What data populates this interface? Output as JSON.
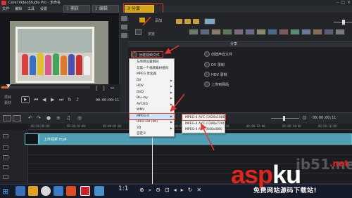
{
  "titlebar": {
    "title": "Corel VideoStudio Pro - 未命名"
  },
  "menubar": {
    "items": [
      "文件",
      "编辑",
      "工具",
      "设置"
    ]
  },
  "steps": {
    "capture": {
      "num": "1",
      "label": "捕获"
    },
    "edit": {
      "num": "2",
      "label": "编辑"
    },
    "share": {
      "num": "3",
      "label": "分享"
    }
  },
  "library": {
    "add_label": "添加",
    "browse_label": "浏览"
  },
  "share_panel": {
    "header": "分享",
    "create_video": "创建视频文件",
    "create_audio": "创建声音文件",
    "dv_record": "DV 录制",
    "hdv_record": "HDV 录制",
    "upload_web": "上传到网站"
  },
  "menu_create_video": {
    "items": [
      "与项目设置相同",
      "与第一个视频素材相同",
      "MPEG 优化器",
      "DV",
      "HDV",
      "DVD",
      "Blu-ray",
      "AVCHD",
      "WMV",
      "MPEG-4",
      "Ultra HD (4K)",
      "3D",
      "自定义"
    ],
    "submenu_flags": [
      false,
      false,
      false,
      true,
      true,
      true,
      true,
      true,
      true,
      true,
      true,
      true,
      false
    ],
    "hover_index": 9
  },
  "menu_mpeg4": {
    "items": [
      "MPEG-4 AVC (1920x1080)",
      "MPEG-4 AVC (1280x720)",
      "MPEG-4 AVC (640x480)"
    ]
  },
  "preview": {
    "timecode": "00:00:00:11",
    "progress": 0.08,
    "mode_project": "项目",
    "mode_clip": "素材"
  },
  "timeline": {
    "ruler_labels": [
      "00:00:00:00",
      "00:00:02:00",
      "00:00:04:00",
      "00:00:06:00",
      "00:00:08:00",
      "00:00:10:00",
      "00:00:12:00",
      "00:00:14:00",
      "00:00:16:00"
    ],
    "clip_name": "上传视频.mp4"
  },
  "taskbar": {
    "zoom_label": "1:1"
  },
  "watermark": {
    "brand_a": "asp",
    "brand_b": "ku",
    "brand_tld": ".net",
    "subtitle": "免费网站源码下载站!",
    "faint": "jb51.net"
  },
  "colors": {
    "accent_orange": "#d8a417",
    "highlight_red": "#e43a2a",
    "clip_blue": "#4e9fb5"
  }
}
